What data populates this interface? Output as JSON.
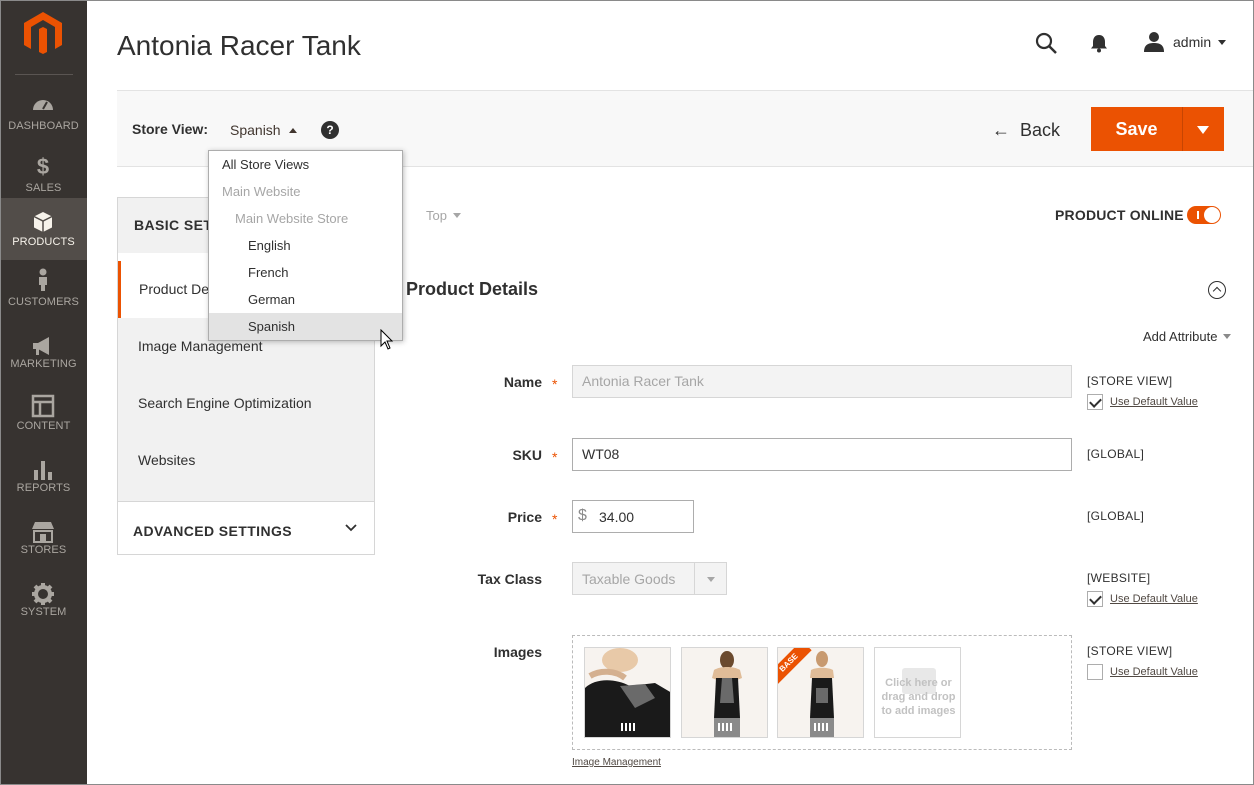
{
  "sidebar": {
    "items": [
      {
        "label": "DASHBOARD",
        "icon": "dashboard-icon"
      },
      {
        "label": "SALES",
        "icon": "dollar-icon"
      },
      {
        "label": "PRODUCTS",
        "icon": "box-icon",
        "active": true
      },
      {
        "label": "CUSTOMERS",
        "icon": "person-icon"
      },
      {
        "label": "MARKETING",
        "icon": "megaphone-icon"
      },
      {
        "label": "CONTENT",
        "icon": "layout-icon"
      },
      {
        "label": "REPORTS",
        "icon": "bar-chart-icon"
      },
      {
        "label": "STORES",
        "icon": "storefront-icon"
      },
      {
        "label": "SYSTEM",
        "icon": "gear-icon"
      }
    ]
  },
  "header": {
    "title": "Antonia Racer Tank",
    "user": "admin"
  },
  "toolbar": {
    "store_view_label": "Store View:",
    "store_view_value": "Spanish",
    "help": "?",
    "back_label": "Back",
    "save_label": "Save"
  },
  "store_dropdown": {
    "items": [
      {
        "label": "All Store Views"
      },
      {
        "label": "Main Website"
      },
      {
        "label": "Main Website Store"
      },
      {
        "label": "English"
      },
      {
        "label": "French"
      },
      {
        "label": "German"
      },
      {
        "label": "Spanish"
      }
    ]
  },
  "left_panel": {
    "basic_settings": "BASIC SETTINGS",
    "items": [
      {
        "label": "Product Details"
      },
      {
        "label": "Image Management"
      },
      {
        "label": "Search Engine Optimization"
      },
      {
        "label": "Websites"
      }
    ],
    "advanced_settings": "ADVANCED SETTINGS"
  },
  "main": {
    "scope_top": "Top",
    "product_online_label": "PRODUCT ONLINE",
    "product_online": true,
    "section_title": "Product Details",
    "add_attribute": "Add Attribute",
    "use_default_value": "Use Default Value",
    "fields": {
      "name": {
        "label": "Name",
        "value": "Antonia Racer Tank",
        "scope": "[STORE VIEW]",
        "use_default": true
      },
      "sku": {
        "label": "SKU",
        "value": "WT08",
        "scope": "[GLOBAL]"
      },
      "price": {
        "label": "Price",
        "currency": "$",
        "value": "34.00",
        "scope": "[GLOBAL]"
      },
      "tax_class": {
        "label": "Tax Class",
        "value": "Taxable Goods",
        "scope": "[WEBSITE]",
        "use_default": true
      },
      "images": {
        "label": "Images",
        "scope": "[STORE VIEW]",
        "use_default": false
      }
    },
    "required_mark": "*",
    "base_badge": "BASE",
    "add_image_text": "Click here or drag and drop to add images",
    "image_management_link": "Image Management"
  }
}
